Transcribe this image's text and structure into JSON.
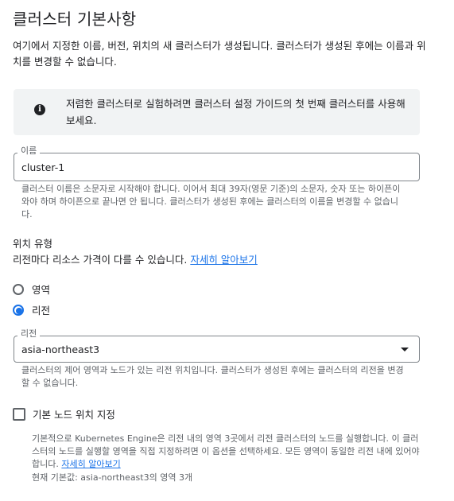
{
  "header": {
    "title": "클러스터 기본사항",
    "intro": "여기에서 지정한 이름, 버전, 위치의 새 클러스터가 생성됩니다. 클러스터가 생성된 후에는 이름과 위치를 변경할 수 없습니다."
  },
  "info_banner": {
    "icon": "info-icon",
    "text": "저렴한 클러스터로 실험하려면 클러스터 설정 가이드의 첫 번째 클러스터를 사용해 보세요."
  },
  "name_field": {
    "label": "이름",
    "value": "cluster-1",
    "hint": "클러스터 이름은 소문자로 시작해야 합니다. 이어서 최대 39자(영문 기준)의 소문자, 숫자 또는 하이픈이 와야 하며 하이픈으로 끝나면 안 됩니다. 클러스터가 생성된 후에는 클러스터의 이름을 변경할 수 없습니다."
  },
  "location_type": {
    "title": "위치 유형",
    "subtitle": "리전마다 리소스 가격이 다를 수 있습니다.",
    "learn_more": "자세히 알아보기",
    "options": [
      {
        "label": "영역",
        "checked": false
      },
      {
        "label": "리전",
        "checked": true
      }
    ]
  },
  "region_field": {
    "label": "리전",
    "value": "asia-northeast3",
    "hint": "클러스터의 제어 영역과 노드가 있는 리전 위치입니다. 클러스터가 생성된 후에는 클러스터의 리전을 변경할 수 없습니다."
  },
  "default_node_locations": {
    "label": "기본 노드 위치 지정",
    "checked": false,
    "description": "기본적으로 Kubernetes Engine은 리전 내의 영역 3곳에서 리전 클러스터의 노드를 실행합니다. 이 클러스터의 노드를 실행할 영역을 직접 지정하려면 이 옵션을 선택하세요. 모든 영역이 동일한 리전 내에 있어야 합니다.",
    "learn_more": "자세히 알아보기",
    "current_default": "현재 기본값: asia-northeast3의 영역 3개"
  },
  "colors": {
    "accent": "#1a73e8",
    "text": "#202124",
    "secondary_text": "#5f6368",
    "banner_bg": "#f1f3f4"
  }
}
